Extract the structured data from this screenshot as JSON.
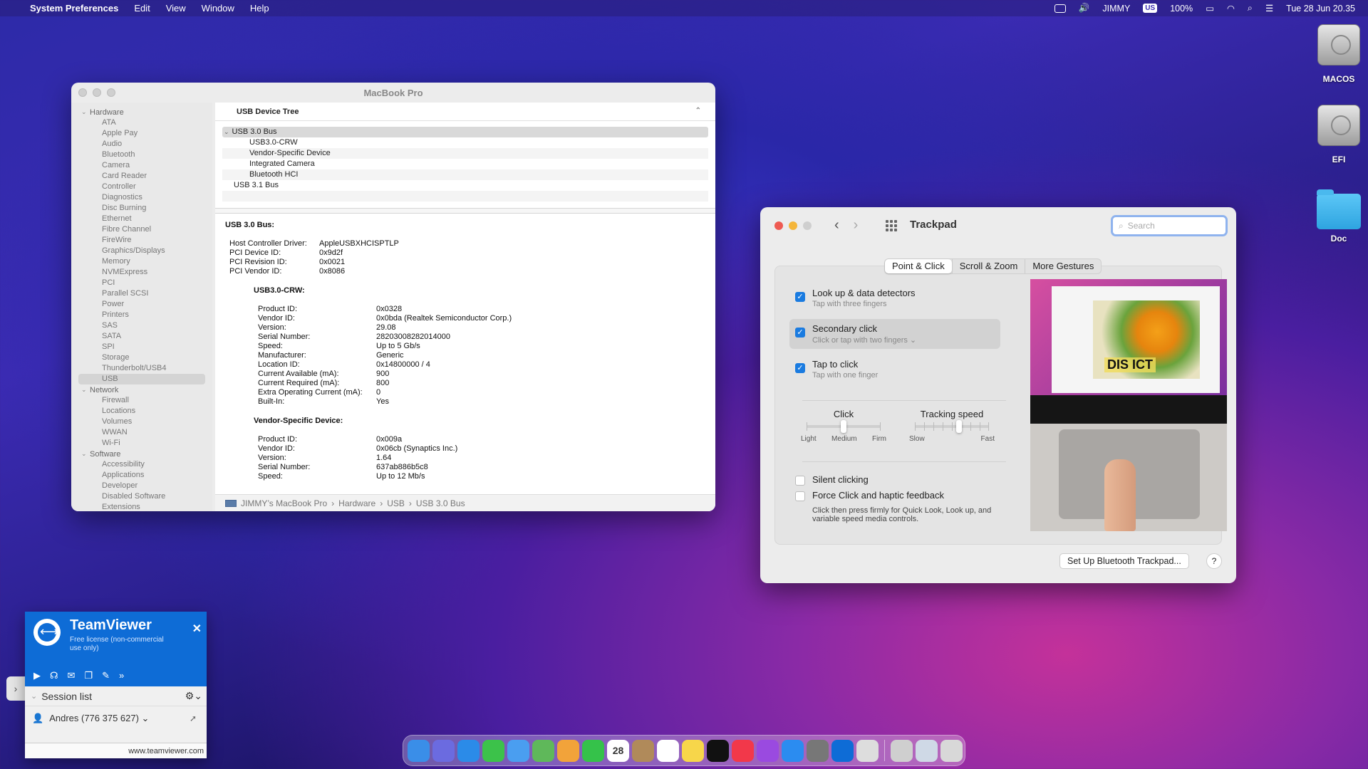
{
  "menubar": {
    "apple": "",
    "app_name": "System Preferences",
    "menus": [
      "Edit",
      "View",
      "Window",
      "Help"
    ],
    "user": "JIMMY",
    "input_source": "US",
    "battery": "100%",
    "datetime": "Tue 28 Jun  20.35"
  },
  "desktop": {
    "icons": [
      {
        "label": "MACOS",
        "icon": "hard-disk-icon"
      },
      {
        "label": "EFI",
        "icon": "hard-disk-icon"
      },
      {
        "label": "Doc",
        "icon": "folder-icon"
      }
    ]
  },
  "sysinfo": {
    "title": "MacBook Pro",
    "sidebar": {
      "groups": [
        {
          "label": "Hardware",
          "items": [
            "ATA",
            "Apple Pay",
            "Audio",
            "Bluetooth",
            "Camera",
            "Card Reader",
            "Controller",
            "Diagnostics",
            "Disc Burning",
            "Ethernet",
            "Fibre Channel",
            "FireWire",
            "Graphics/Displays",
            "Memory",
            "NVMExpress",
            "PCI",
            "Parallel SCSI",
            "Power",
            "Printers",
            "SAS",
            "SATA",
            "SPI",
            "Storage",
            "Thunderbolt/USB4",
            "USB"
          ]
        },
        {
          "label": "Network",
          "items": [
            "Firewall",
            "Locations",
            "Volumes",
            "WWAN",
            "Wi-Fi"
          ]
        },
        {
          "label": "Software",
          "items": [
            "Accessibility",
            "Applications",
            "Developer",
            "Disabled Software",
            "Extensions"
          ]
        }
      ],
      "selected": "USB"
    },
    "tree_header": "USB Device Tree",
    "tree": [
      {
        "label": "USB 3.0 Bus",
        "level": 0,
        "expanded": true,
        "selected": true
      },
      {
        "label": "USB3.0-CRW",
        "level": 1
      },
      {
        "label": "Vendor-Specific Device",
        "level": 1
      },
      {
        "label": "Integrated Camera",
        "level": 1
      },
      {
        "label": "Bluetooth HCI",
        "level": 1
      },
      {
        "label": "USB 3.1 Bus",
        "level": 0
      }
    ],
    "detail": {
      "heading": "USB 3.0 Bus:",
      "bus": [
        {
          "k": "Host Controller Driver:",
          "v": "AppleUSBXHCISPTLP"
        },
        {
          "k": "PCI Device ID:",
          "v": "0x9d2f"
        },
        {
          "k": "PCI Revision ID:",
          "v": "0x0021"
        },
        {
          "k": "PCI Vendor ID:",
          "v": "0x8086"
        }
      ],
      "devices": [
        {
          "name": "USB3.0-CRW:",
          "props": [
            {
              "k": "Product ID:",
              "v": "0x0328"
            },
            {
              "k": "Vendor ID:",
              "v": "0x0bda  (Realtek Semiconductor Corp.)"
            },
            {
              "k": "Version:",
              "v": "29.08"
            },
            {
              "k": "Serial Number:",
              "v": "28203008282014000"
            },
            {
              "k": "Speed:",
              "v": "Up to 5 Gb/s"
            },
            {
              "k": "Manufacturer:",
              "v": "Generic"
            },
            {
              "k": "Location ID:",
              "v": "0x14800000 / 4"
            },
            {
              "k": "Current Available (mA):",
              "v": "900"
            },
            {
              "k": "Current Required (mA):",
              "v": "800"
            },
            {
              "k": "Extra Operating Current (mA):",
              "v": "0"
            },
            {
              "k": "Built-In:",
              "v": "Yes"
            }
          ]
        },
        {
          "name": "Vendor-Specific Device:",
          "props": [
            {
              "k": "Product ID:",
              "v": "0x009a"
            },
            {
              "k": "Vendor ID:",
              "v": "0x06cb  (Synaptics Inc.)"
            },
            {
              "k": "Version:",
              "v": "1.64"
            },
            {
              "k": "Serial Number:",
              "v": "637ab886b5c8"
            },
            {
              "k": "Speed:",
              "v": "Up to 12 Mb/s"
            }
          ]
        }
      ]
    },
    "breadcrumb": [
      "JIMMY’s MacBook Pro",
      "Hardware",
      "USB",
      "USB 3.0 Bus"
    ]
  },
  "trackpad": {
    "title": "Trackpad",
    "search_placeholder": "Search",
    "tabs": [
      "Point & Click",
      "Scroll & Zoom",
      "More Gestures"
    ],
    "selected_tab": "Point & Click",
    "options": [
      {
        "title": "Look up & data detectors",
        "sub": "Tap with three fingers",
        "checked": true
      },
      {
        "title": "Secondary click",
        "sub": "Click or tap with two fingers ⌄",
        "checked": true
      },
      {
        "title": "Tap to click",
        "sub": "Tap with one finger",
        "checked": true
      }
    ],
    "click_slider": {
      "label": "Click",
      "scale": [
        "Light",
        "Medium",
        "Firm"
      ],
      "value": "Medium"
    },
    "tracking_slider": {
      "label": "Tracking speed",
      "scale": [
        "Slow",
        "Fast"
      ],
      "value_fraction": 0.6
    },
    "silent_clicking": {
      "title": "Silent clicking",
      "checked": false
    },
    "force_click": {
      "title": "Force Click and haptic feedback",
      "sub": "Click then press firmly for Quick Look, Look up, and variable speed media controls.",
      "checked": false
    },
    "preview_word": "DIS   ICT",
    "setup_button": "Set Up Bluetooth Trackpad...",
    "help": "?"
  },
  "teamviewer": {
    "name": "TeamViewer",
    "license": "Free license (non-commercial use only)",
    "session_list": "Session list",
    "session": "Andres (776 375 627) ⌄",
    "footer": "www.teamviewer.com"
  },
  "dock": {
    "date": "28",
    "apps": [
      {
        "name": "finder-icon",
        "color": "#3a8ee8"
      },
      {
        "name": "launchpad-icon",
        "color": "#6b6be0"
      },
      {
        "name": "safari-icon",
        "color": "#2b8be8"
      },
      {
        "name": "messages-icon",
        "color": "#3cc24a"
      },
      {
        "name": "mail-icon",
        "color": "#4a9ef0"
      },
      {
        "name": "maps-icon",
        "color": "#5fb85a"
      },
      {
        "name": "photos-icon",
        "color": "#f2a33a"
      },
      {
        "name": "facetime-icon",
        "color": "#35c24a"
      },
      {
        "name": "calendar-icon",
        "color": "#ffffff"
      },
      {
        "name": "contacts-icon",
        "color": "#b08a5a"
      },
      {
        "name": "reminders-icon",
        "color": "#ffffff"
      },
      {
        "name": "notes-icon",
        "color": "#f7d64a"
      },
      {
        "name": "tv-icon",
        "color": "#111111"
      },
      {
        "name": "music-icon",
        "color": "#f2384a"
      },
      {
        "name": "podcasts-icon",
        "color": "#9a4ae0"
      },
      {
        "name": "app-store-icon",
        "color": "#2b8cf0"
      },
      {
        "name": "system-preferences-icon",
        "color": "#777777"
      },
      {
        "name": "teamviewer-icon",
        "color": "#0e6cd6"
      },
      {
        "name": "preview-icon",
        "color": "#dddddd"
      },
      {
        "name": "documents-icon",
        "color": "#cfcfcf"
      },
      {
        "name": "downloads-icon",
        "color": "#cfd9e6"
      },
      {
        "name": "trash-icon",
        "color": "#d8d8d8"
      }
    ]
  }
}
